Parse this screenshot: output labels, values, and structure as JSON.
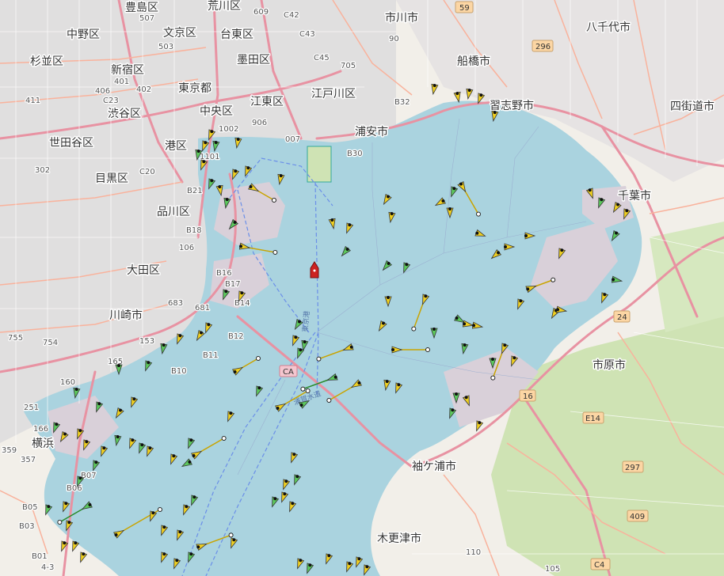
{
  "map": {
    "colors": {
      "water": "#aad3df",
      "land": "#f2efe9",
      "urban": "#e0dfdf",
      "forest": "#cfe3b4",
      "industrial": "#dcd3dc",
      "highway": "#e892a2",
      "trunk": "#f9b29c",
      "primary": "#fcd6a4",
      "ship_cargo": "#5cc85c",
      "ship_other": "#f0d020",
      "ship_own": "#cc2222"
    },
    "places": [
      {
        "name": "豊島区"
      },
      {
        "name": "荒川区"
      },
      {
        "name": "中野区"
      },
      {
        "name": "文京区"
      },
      {
        "name": "台東区"
      },
      {
        "name": "杉並区"
      },
      {
        "name": "新宿区"
      },
      {
        "name": "墨田区"
      },
      {
        "name": "東京都"
      },
      {
        "name": "渋谷区"
      },
      {
        "name": "中央区"
      },
      {
        "name": "江東区"
      },
      {
        "name": "江戸川区"
      },
      {
        "name": "世田谷区"
      },
      {
        "name": "港区"
      },
      {
        "name": "浦安市"
      },
      {
        "name": "目黒区"
      },
      {
        "name": "品川区"
      },
      {
        "name": "大田区"
      },
      {
        "name": "川崎市"
      },
      {
        "name": "横浜"
      },
      {
        "name": "市川市"
      },
      {
        "name": "船橋市"
      },
      {
        "name": "習志野市"
      },
      {
        "name": "八千代市"
      },
      {
        "name": "四街道市"
      },
      {
        "name": "千葉市"
      },
      {
        "name": "市原市"
      },
      {
        "name": "袖ケ浦市"
      },
      {
        "name": "木更津市"
      }
    ],
    "road_refs": [
      {
        "text": "507"
      },
      {
        "text": "C42"
      },
      {
        "text": "609"
      },
      {
        "text": "C43"
      },
      {
        "text": "503"
      },
      {
        "text": "59"
      },
      {
        "text": "C45"
      },
      {
        "text": "705"
      },
      {
        "text": "90"
      },
      {
        "text": "406"
      },
      {
        "text": "C23"
      },
      {
        "text": "402"
      },
      {
        "text": "401"
      },
      {
        "text": "411"
      },
      {
        "text": "1002"
      },
      {
        "text": "906"
      },
      {
        "text": "B32"
      },
      {
        "text": "007"
      },
      {
        "text": "1101"
      },
      {
        "text": "B30"
      },
      {
        "text": "302"
      },
      {
        "text": "C20"
      },
      {
        "text": "B21"
      },
      {
        "text": "B18"
      },
      {
        "text": "106"
      },
      {
        "text": "B16"
      },
      {
        "text": "B17"
      },
      {
        "text": "B14"
      },
      {
        "text": "683"
      },
      {
        "text": "681"
      },
      {
        "text": "B12"
      },
      {
        "text": "B11"
      },
      {
        "text": "B10"
      },
      {
        "text": "755"
      },
      {
        "text": "754"
      },
      {
        "text": "153"
      },
      {
        "text": "165"
      },
      {
        "text": "160"
      },
      {
        "text": "251"
      },
      {
        "text": "166"
      },
      {
        "text": "359"
      },
      {
        "text": "357"
      },
      {
        "text": "B07"
      },
      {
        "text": "B06"
      },
      {
        "text": "B05"
      },
      {
        "text": "B03"
      },
      {
        "text": "B01"
      },
      {
        "text": "4-3"
      },
      {
        "text": "E14"
      },
      {
        "text": "110"
      },
      {
        "text": "105"
      }
    ],
    "shields": [
      {
        "text": "59"
      },
      {
        "text": "296"
      },
      {
        "text": "24"
      },
      {
        "text": "16"
      },
      {
        "text": "CA"
      },
      {
        "text": "E14"
      },
      {
        "text": "297"
      },
      {
        "text": "409"
      },
      {
        "text": "C4"
      }
    ],
    "water_labels": [
      {
        "text": "東京港"
      },
      {
        "text": "浦賀水道"
      }
    ]
  }
}
